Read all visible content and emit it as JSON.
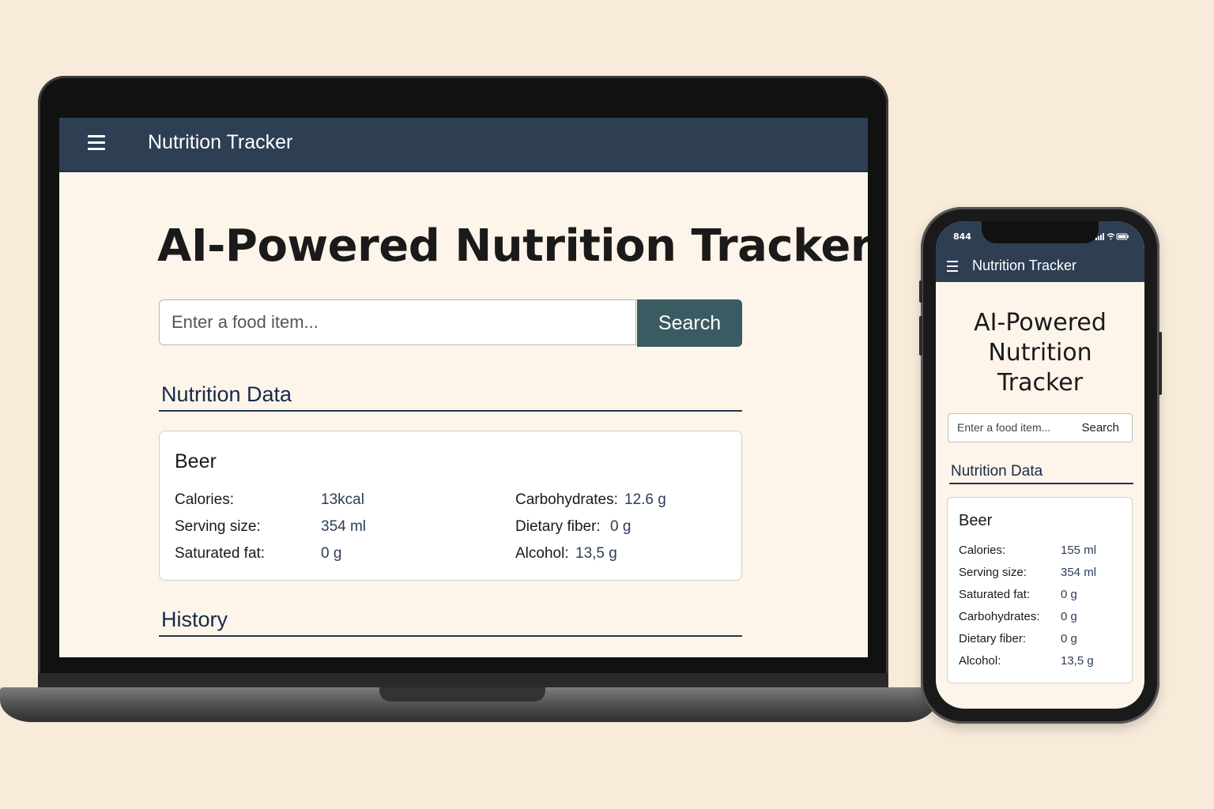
{
  "laptop": {
    "header": {
      "menu_icon": "hamburger-icon",
      "title": "Nutrition Tracker"
    },
    "main": {
      "heading": "AI-Powered Nutrition Tracker",
      "search": {
        "placeholder": "Enter a food item...",
        "button_label": "Search"
      },
      "nutrition_section_label": "Nutrition Data",
      "card": {
        "food_name": "Beer",
        "left_rows": [
          {
            "label": "Calories:",
            "value": "13kcal"
          },
          {
            "label": "Serving size:",
            "value": "354 ml"
          },
          {
            "label": "Saturated fat:",
            "value": "0 g"
          }
        ],
        "right_rows": [
          {
            "label": "Carbohydrates:",
            "value": "12.6 g"
          },
          {
            "label": "Dietary fiber:",
            "value": "0 g"
          },
          {
            "label": "Alcohol:",
            "value": "13,5 g"
          }
        ]
      },
      "history_section_label": "History"
    }
  },
  "phone": {
    "status": {
      "time": "844",
      "indicators": "signal-wifi-battery-icons"
    },
    "header": {
      "menu_icon": "hamburger-icon",
      "title": "Nutrition Tracker"
    },
    "main": {
      "heading_lines": [
        "AI-Powered",
        "Nutrition",
        "Tracker"
      ],
      "search": {
        "placeholder": "Enter a food item...",
        "button_label": "Search"
      },
      "nutrition_section_label": "Nutrition Data",
      "card": {
        "food_name": "Beer",
        "rows": [
          {
            "label": "Calories:",
            "value": "155 ml"
          },
          {
            "label": "Serving size:",
            "value": "354 ml"
          },
          {
            "label": "Saturated fat:",
            "value": "0 g"
          },
          {
            "label": "Carbohydrates:",
            "value": "0 g"
          },
          {
            "label": "Dietary fiber:",
            "value": "0 g"
          },
          {
            "label": "Alcohol:",
            "value": "13,5 g"
          }
        ]
      }
    }
  },
  "colors": {
    "background": "#f8ebda",
    "header": "#2e3f54",
    "search_button": "#3b5b62",
    "section_text": "#17294a"
  }
}
